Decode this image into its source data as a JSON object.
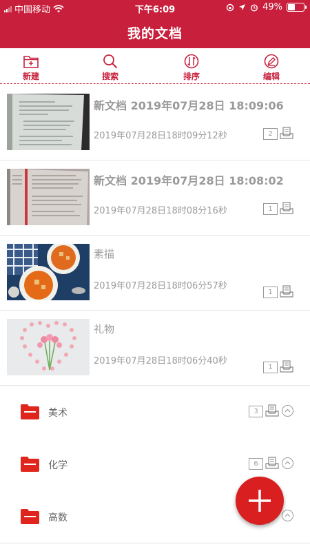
{
  "status_bar": {
    "carrier": "中国移动",
    "time": "下午6:09",
    "battery": "49%",
    "battery_level": 0.49
  },
  "header": {
    "title": "我的文档"
  },
  "toolbar": {
    "new_label": "新建",
    "search_label": "搜索",
    "sort_label": "排序",
    "edit_label": "编辑"
  },
  "documents": [
    {
      "title": "新文档 2019年07月28日 18:09:06",
      "date": "2019年07月28日18时09分12秒",
      "count": "2",
      "thumb": "book-page"
    },
    {
      "title": "新文档 2019年07月28日 18:08:02",
      "date": "2019年07月28日18时08分16秒",
      "count": "1",
      "thumb": "book-page-red"
    },
    {
      "title": "素描",
      "date": "2019年07月28日18时06分57秒",
      "count": "1",
      "thumb": "soup-bowls"
    },
    {
      "title": "礼物",
      "date": "2019年07月28日18时06分40秒",
      "count": "1",
      "thumb": "flowers-heart"
    }
  ],
  "folders": [
    {
      "name": "美术",
      "count": "3"
    },
    {
      "name": "化学",
      "count": "6"
    },
    {
      "name": "高数",
      "count": ""
    }
  ],
  "colors": {
    "brand": "#c8203c",
    "fab": "#d91f1f",
    "folder": "#e0261c"
  }
}
